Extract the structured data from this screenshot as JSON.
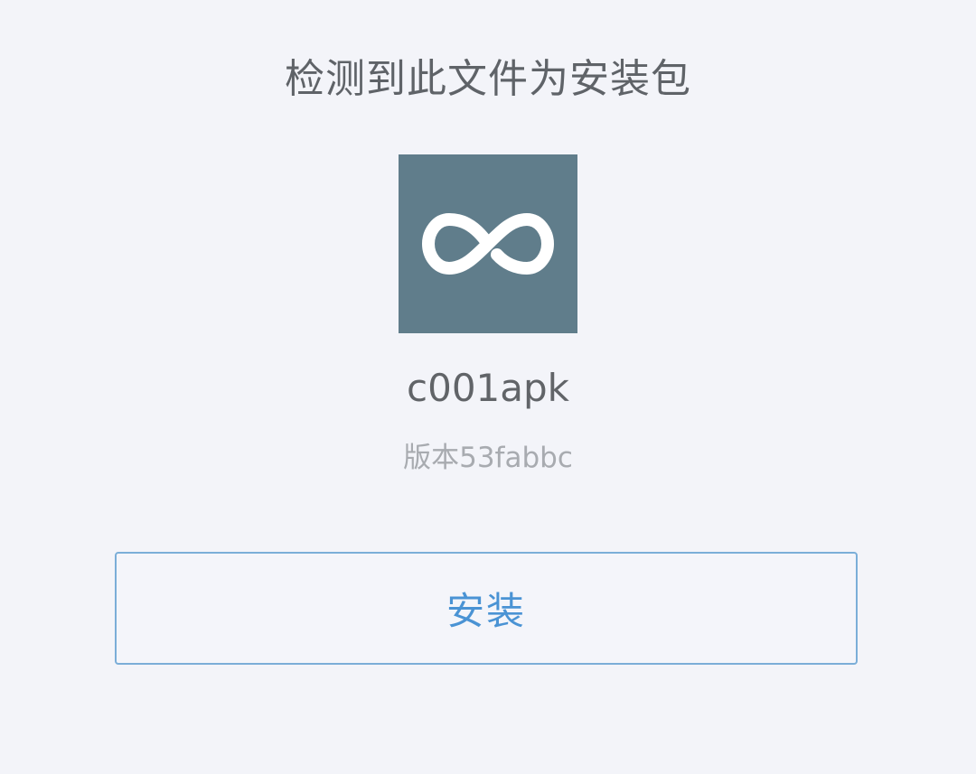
{
  "dialog": {
    "title": "检测到此文件为安装包",
    "app_icon": "infinity-icon",
    "app_name": "c001apk",
    "version": "版本53fabbc",
    "install_label": "安装"
  },
  "colors": {
    "background": "#f3f4f9",
    "icon_background": "#607d8b",
    "accent": "#4a93d4",
    "button_border": "#7baed8"
  }
}
